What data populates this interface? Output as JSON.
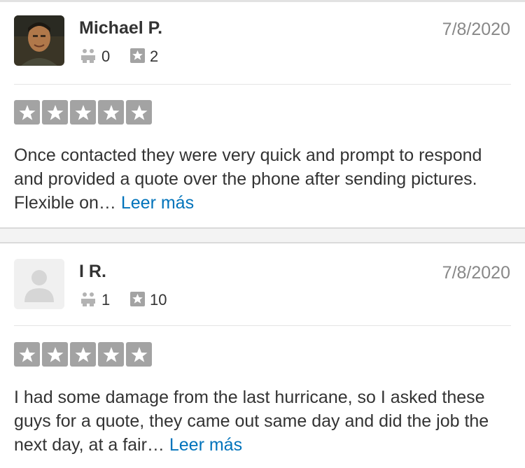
{
  "reviews": [
    {
      "name": "Michael P.",
      "date": "7/8/2020",
      "friends": "0",
      "reviews_count": "2",
      "rating": 5,
      "text_before": "Once contacted they were very quick and prompt to respond and provided a quote over the phone after sending pictures.  Flexible on… ",
      "more_label": "Leer más",
      "avatar_icon": "user-photo"
    },
    {
      "name": "I R.",
      "date": "7/8/2020",
      "friends": "1",
      "reviews_count": "10",
      "rating": 5,
      "text_before": "I had some damage from the last hurricane, so I asked these guys for a quote, they came out same day and did the job the next day, at a fair… ",
      "more_label": "Leer más",
      "avatar_icon": "default-avatar"
    }
  ],
  "colors": {
    "link": "#0073bb",
    "star_box": "#a3a3a3",
    "date": "#888888"
  }
}
